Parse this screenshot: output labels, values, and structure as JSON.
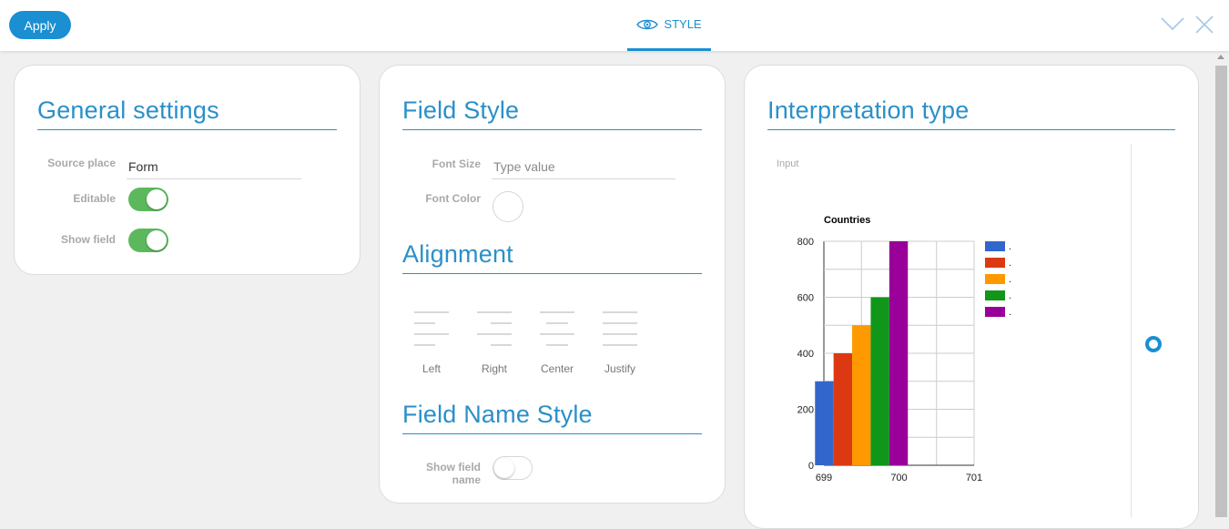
{
  "toolbar": {
    "apply_label": "Apply",
    "tab_label": "STYLE"
  },
  "general": {
    "title": "General settings",
    "source_place_label": "Source place",
    "source_place_value": "Form",
    "editable_label": "Editable",
    "editable": true,
    "show_field_label": "Show field",
    "show_field": true
  },
  "field_style": {
    "title": "Field Style",
    "font_size_label": "Font Size",
    "font_size_placeholder": "Type value",
    "font_color_label": "Font Color"
  },
  "alignment": {
    "title": "Alignment",
    "options": [
      "Left",
      "Right",
      "Center",
      "Justify"
    ]
  },
  "field_name_style": {
    "title": "Field Name Style",
    "show_field_name_label": "Show field name",
    "show_field_name": false
  },
  "interpretation": {
    "title": "Interpretation type",
    "input_label": "Input"
  },
  "chart_data": {
    "type": "bar",
    "title": "Countries",
    "x_ticks": [
      "699",
      "700",
      "701"
    ],
    "y_ticks": [
      "0",
      "200",
      "400",
      "600",
      "800"
    ],
    "ylim": [
      0,
      800
    ],
    "xlim": [
      699,
      701
    ],
    "legend_position": "right",
    "series": [
      {
        "name": ".",
        "x": 699.5,
        "value": 300,
        "color": "#3366cc"
      },
      {
        "name": ".",
        "x": 699.5,
        "value": 400,
        "color": "#dc3912"
      },
      {
        "name": ".",
        "x": 699.5,
        "value": 500,
        "color": "#ff9900"
      },
      {
        "name": ".",
        "x": 699.5,
        "value": 600,
        "color": "#109618"
      },
      {
        "name": ".",
        "x": 699.5,
        "value": 800,
        "color": "#990099"
      }
    ]
  }
}
